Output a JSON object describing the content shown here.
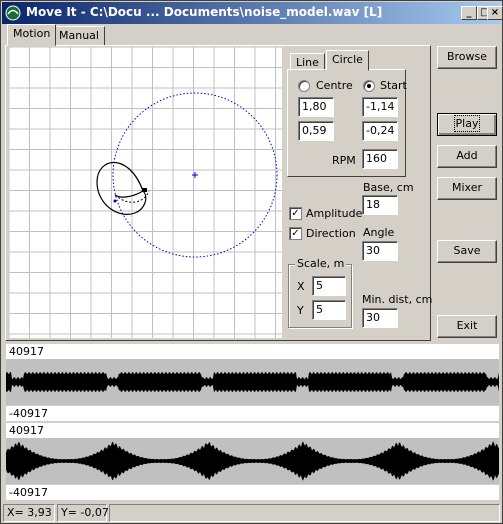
{
  "window": {
    "title": "Move It - C:\\Docu ... Documents\\noise_model.wav [L]",
    "minimize_glyph": "_",
    "maximize_glyph": "□",
    "close_glyph": "×"
  },
  "tabs": [
    {
      "label": "Motion",
      "active": true
    },
    {
      "label": "Manual",
      "active": false
    }
  ],
  "subtabs": [
    {
      "label": "Line",
      "active": false
    },
    {
      "label": "Circle",
      "active": true
    }
  ],
  "circle": {
    "centre_label": "Centre",
    "start_label": "Start",
    "selected": "start",
    "centre_x": "1,80",
    "centre_y": "0,59",
    "start_x": "-1,14",
    "start_y": "-0,24",
    "rpm_label": "RPM",
    "rpm": "160"
  },
  "options": {
    "amplitude_label": "Amplitude",
    "amplitude_checked": true,
    "direction_label": "Direction",
    "direction_checked": true,
    "check_glyph": "✓"
  },
  "base": {
    "label": "Base, cm",
    "value": "18"
  },
  "angle": {
    "label": "Angle",
    "value": "30"
  },
  "min_dist": {
    "label": "Min. dist, cm",
    "value": "30"
  },
  "scale": {
    "title": "Scale, m",
    "x_label": "X",
    "x_value": "5",
    "y_label": "Y",
    "y_value": "5"
  },
  "buttons": {
    "browse": "Browse",
    "play": "Play",
    "add": "Add",
    "mixer": "Mixer",
    "save": "Save",
    "exit": "Exit"
  },
  "waveforms": [
    {
      "max_label": "40917",
      "min_label": "-40917"
    },
    {
      "max_label": "40917",
      "min_label": "-40917"
    }
  ],
  "status": {
    "x": "X= 3,93",
    "y": "Y= -0,07"
  },
  "colors": {
    "titlebar_start": "#0a246a",
    "titlebar_end": "#a6caf0",
    "circle_dotted": "#0000cc",
    "grid": "#c0c0c0"
  }
}
